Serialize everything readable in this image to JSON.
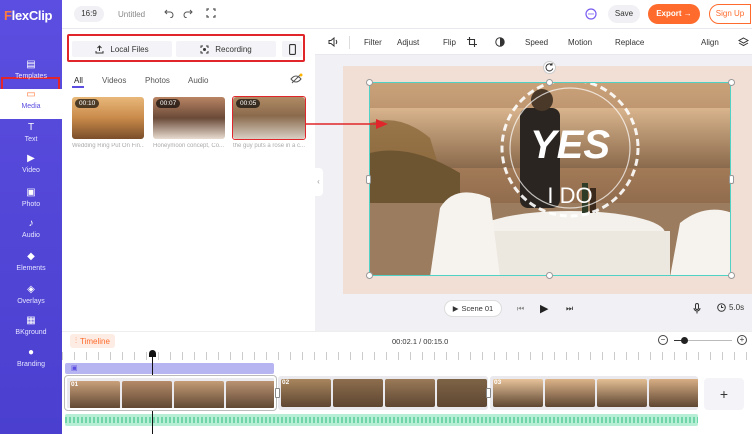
{
  "app": {
    "logo": "FlexClip"
  },
  "sidebar": {
    "items": [
      {
        "label": "Templates",
        "icon": "templates-icon"
      },
      {
        "label": "Media",
        "icon": "folder-icon"
      },
      {
        "label": "Text",
        "icon": "text-icon"
      },
      {
        "label": "Video",
        "icon": "video-icon"
      },
      {
        "label": "Photo",
        "icon": "photo-icon"
      },
      {
        "label": "Audio",
        "icon": "audio-icon"
      },
      {
        "label": "Elements",
        "icon": "elements-icon"
      },
      {
        "label": "Overlays",
        "icon": "overlays-icon"
      },
      {
        "label": "BKground",
        "icon": "background-icon"
      },
      {
        "label": "Branding",
        "icon": "branding-icon"
      }
    ],
    "active": "Media"
  },
  "topbar": {
    "ratio": "16:9",
    "project_title": "Untitled",
    "save": "Save",
    "export": "Export →",
    "signup": "Sign Up"
  },
  "media_panel": {
    "local_files": "Local Files",
    "recording": "Recording",
    "tabs": [
      "All",
      "Videos",
      "Photos",
      "Audio"
    ],
    "active_tab": "All",
    "items": [
      {
        "duration": "00:10",
        "caption": "Wedding Ring Put On Fin..."
      },
      {
        "duration": "00:07",
        "caption": "Honeymoon concept, Co..."
      },
      {
        "duration": "00:05",
        "caption": "the guy puts a rose in a c..."
      }
    ]
  },
  "editor_toolbar": {
    "tools": [
      "Filter",
      "Adjust",
      "Flip",
      "Speed",
      "Motion",
      "Replace"
    ],
    "align": "Align"
  },
  "overlay_text": {
    "yes": "YES",
    "ido": "I DO"
  },
  "playback": {
    "scene": "Scene 01",
    "duration": "5.0s"
  },
  "timeline": {
    "label": "Timeline",
    "time": "00:02.1 / 00:15.0",
    "clips": [
      "01",
      "02",
      "03"
    ]
  }
}
